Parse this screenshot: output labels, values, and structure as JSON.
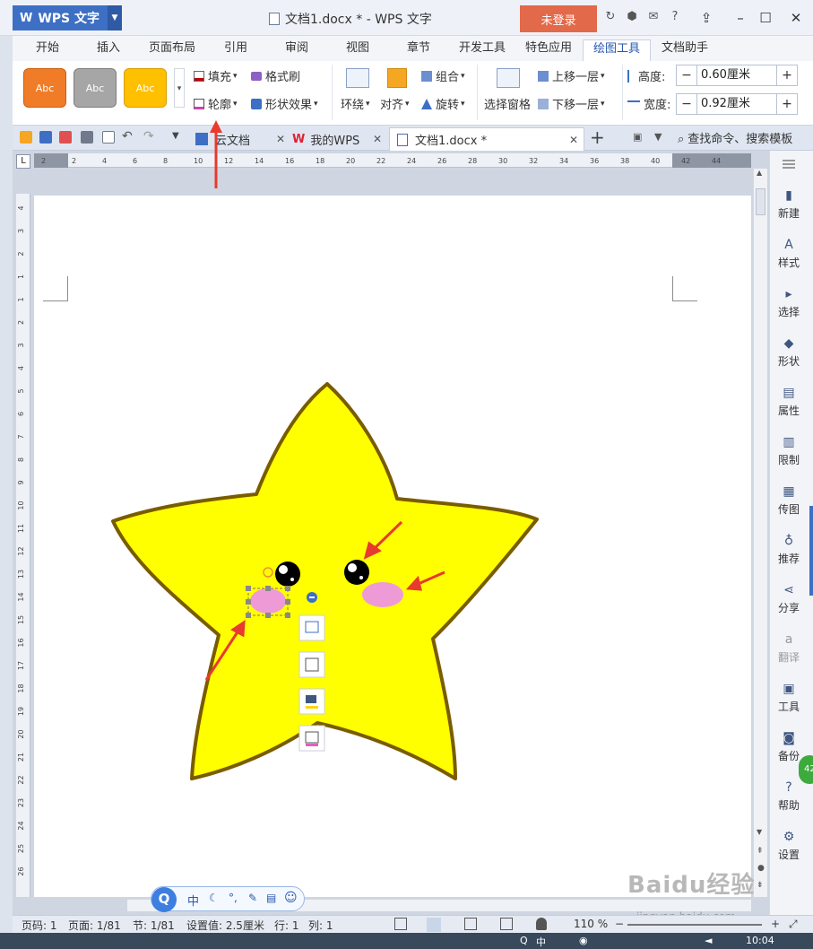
{
  "window": {
    "app_name": "WPS 文字",
    "title": "文档1.docx * - WPS 文字",
    "login_label": "未登录"
  },
  "ribbon_tabs": [
    {
      "label": "开始"
    },
    {
      "label": "插入"
    },
    {
      "label": "页面布局"
    },
    {
      "label": "引用"
    },
    {
      "label": "审阅"
    },
    {
      "label": "视图"
    },
    {
      "label": "章节"
    },
    {
      "label": "开发工具"
    },
    {
      "label": "特色应用"
    },
    {
      "label": "绘图工具"
    },
    {
      "label": "文档助手"
    }
  ],
  "ribbon": {
    "style_swatches": [
      {
        "label": "Abc",
        "color": "#f07c28"
      },
      {
        "label": "Abc",
        "color": "#a6a6a6"
      },
      {
        "label": "Abc",
        "color": "#ffc000"
      }
    ],
    "fill_label": "填充",
    "format_painter_label": "格式刷",
    "outline_label": "轮廓",
    "shape_effects_label": "形状效果",
    "wrap_label": "环绕",
    "align_label": "对齐",
    "group_label": "组合",
    "rotate_label": "旋转",
    "selection_pane_label": "选择窗格",
    "bring_forward_label": "上移一层",
    "send_backward_label": "下移一层",
    "height_label": "高度:",
    "height_value": "0.60厘米",
    "width_label": "宽度:",
    "width_value": "0.92厘米"
  },
  "doc_tabs": [
    {
      "label": "云文档"
    },
    {
      "label": "我的WPS"
    },
    {
      "label": "文档1.docx *"
    }
  ],
  "search_label": "查找命令、搜索模板",
  "sidebar": [
    {
      "label": "新建",
      "icon": "new-doc-icon"
    },
    {
      "label": "样式",
      "icon": "style-icon"
    },
    {
      "label": "选择",
      "icon": "select-icon"
    },
    {
      "label": "形状",
      "icon": "shape-icon"
    },
    {
      "label": "属性",
      "icon": "properties-icon"
    },
    {
      "label": "限制",
      "icon": "restrict-icon"
    },
    {
      "label": "传图",
      "icon": "upload-image-icon"
    },
    {
      "label": "推荐",
      "icon": "recommend-icon"
    },
    {
      "label": "分享",
      "icon": "share-icon"
    },
    {
      "label": "翻译",
      "icon": "translate-icon"
    },
    {
      "label": "工具",
      "icon": "toolbox-icon"
    },
    {
      "label": "备份",
      "icon": "backup-icon"
    },
    {
      "label": "帮助",
      "icon": "help-icon"
    },
    {
      "label": "设置",
      "icon": "settings-icon"
    }
  ],
  "sidebar_badge": "42",
  "ruler_h": [
    "2",
    "2",
    "4",
    "6",
    "8",
    "10",
    "12",
    "14",
    "16",
    "18",
    "20",
    "22",
    "24",
    "26",
    "28",
    "30",
    "32",
    "34",
    "36",
    "38",
    "40",
    "42",
    "44"
  ],
  "ruler_v": [
    "4",
    "3",
    "2",
    "1",
    "1",
    "2",
    "3",
    "4",
    "5",
    "6",
    "7",
    "8",
    "9",
    "10",
    "11",
    "12",
    "13",
    "14",
    "15",
    "16",
    "17",
    "18",
    "19",
    "20",
    "21",
    "22",
    "23",
    "24",
    "25",
    "26"
  ],
  "status": {
    "page_num": "页码: 1",
    "pages": "页面: 1/81",
    "section": "节: 1/81",
    "setting": "设置值: 2.5厘米",
    "row": "行: 1",
    "col": "列: 1",
    "zoom": "110 %"
  },
  "ime": {
    "lang": "中"
  },
  "taskbar": {
    "ime": "中",
    "time": "10:04"
  },
  "watermark": "Baidu经验",
  "watermark_sub": "jingyan.baidu.com",
  "colors": {
    "star_fill": "#ffff00",
    "star_stroke": "#7a5c00",
    "blush": "#ee9ad7",
    "arrow": "#e83a2e",
    "accent": "#3d6fc4"
  }
}
